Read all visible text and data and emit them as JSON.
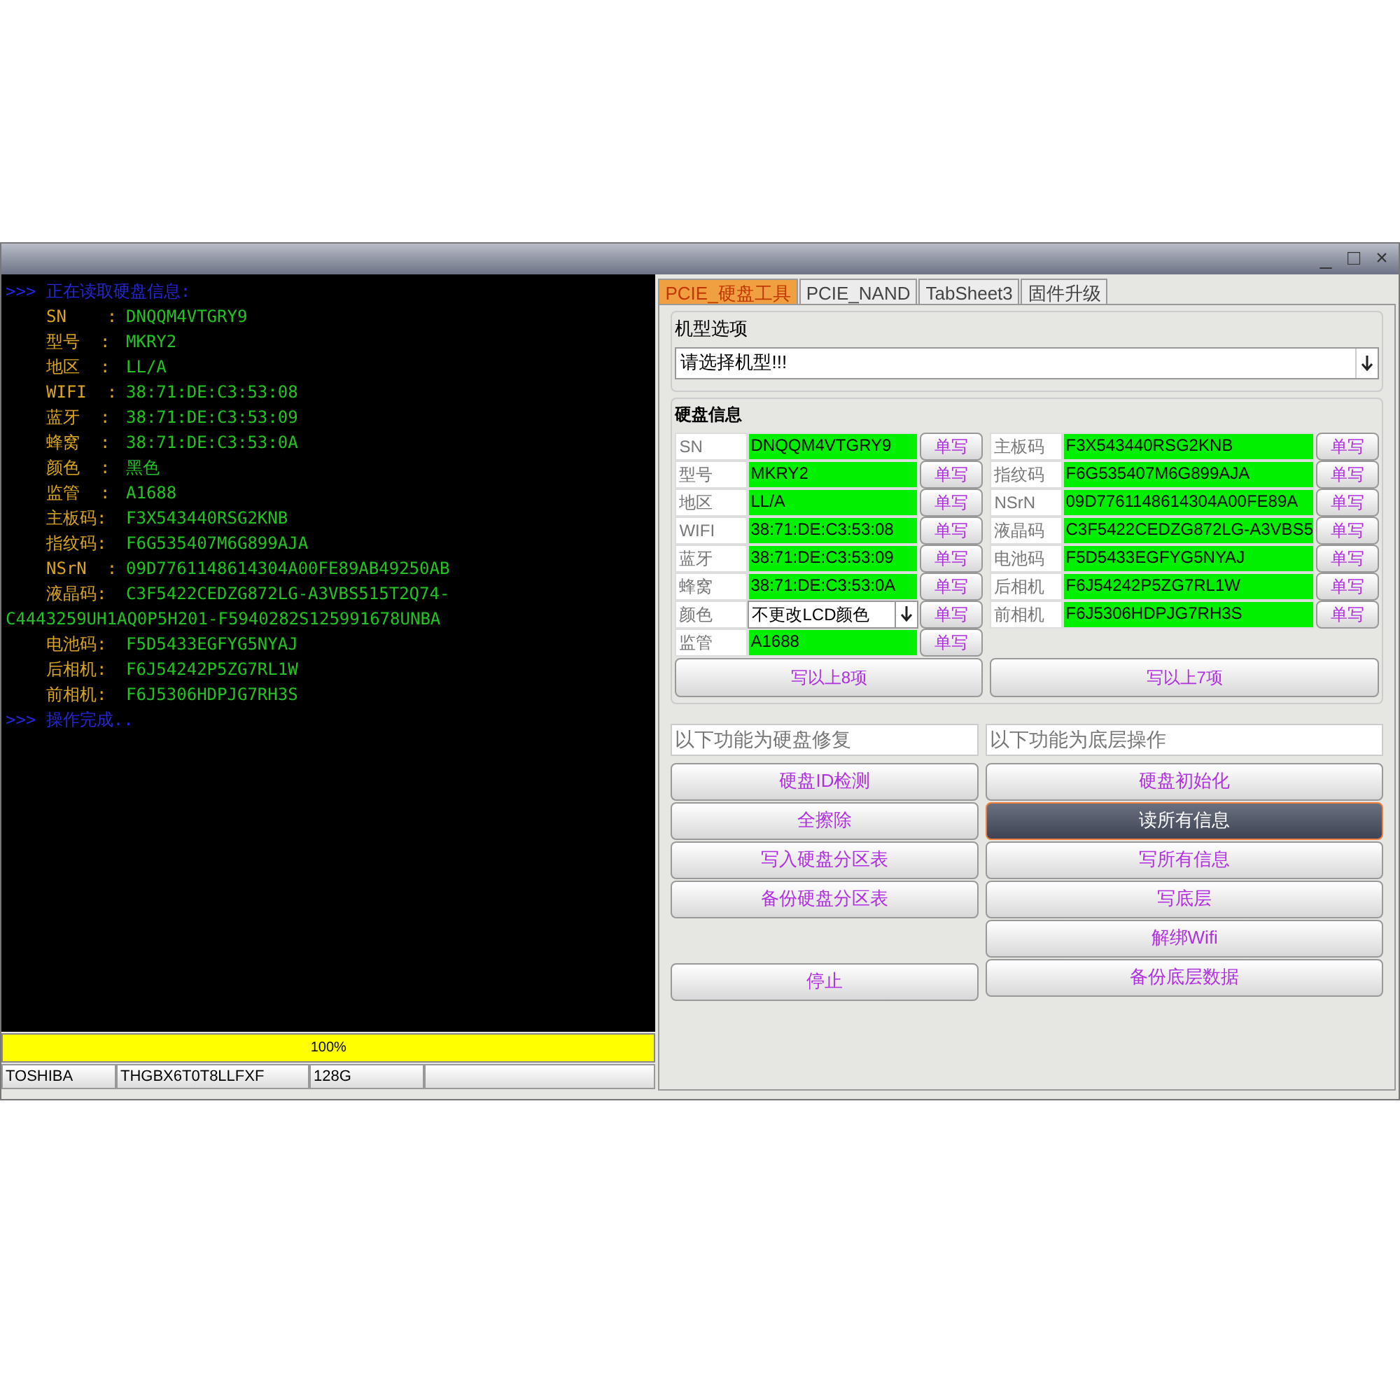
{
  "window": {
    "controls": [
      "_",
      "□",
      "×"
    ]
  },
  "console": {
    "lines": [
      {
        "kind": "header",
        "text": ">>> 正在读取硬盘信息:"
      },
      {
        "kind": "field",
        "label": "SN    :",
        "value": "DNQQM4VTGRY9"
      },
      {
        "kind": "field",
        "label": "型号  :",
        "value": "MKRY2"
      },
      {
        "kind": "field",
        "label": "地区  :",
        "value": "LL/A"
      },
      {
        "kind": "field",
        "label": "WIFI  :",
        "value": "38:71:DE:C3:53:08"
      },
      {
        "kind": "field",
        "label": "蓝牙  :",
        "value": "38:71:DE:C3:53:09"
      },
      {
        "kind": "field",
        "label": "蜂窝  :",
        "value": "38:71:DE:C3:53:0A"
      },
      {
        "kind": "field",
        "label": "颜色  :",
        "value": "黑色"
      },
      {
        "kind": "field",
        "label": "监管  :",
        "value": "A1688"
      },
      {
        "kind": "field",
        "label": "主板码:",
        "value": "F3X543440RSG2KNB"
      },
      {
        "kind": "field",
        "label": "指纹码:",
        "value": "F6G535407M6G899AJA"
      },
      {
        "kind": "field",
        "label": "NSrN  :",
        "value": "09D7761148614304A00FE89AB49250AB"
      },
      {
        "kind": "field",
        "label": "液晶码:",
        "value": "C3F5422CEDZG872LG-A3VBS515T2Q74-"
      },
      {
        "kind": "continuation",
        "text": "C4443259UH1AQ0P5H201-F5940282S125991678UNBA"
      },
      {
        "kind": "field",
        "label": "电池码:",
        "value": "F5D5433EGFYG5NYAJ"
      },
      {
        "kind": "field",
        "label": "后相机:",
        "value": "F6J54242P5ZG7RL1W"
      },
      {
        "kind": "field",
        "label": "前相机:",
        "value": "F6J5306HDPJG7RH3S"
      },
      {
        "kind": "header",
        "text": ">>> 操作完成.."
      }
    ]
  },
  "progress": {
    "level": 1,
    "text": "100%"
  },
  "status_bar": [
    "TOSHIBA",
    "THGBX6T0T8LLFXF",
    "128G"
  ],
  "tabs": [
    {
      "label": "PCIE_硬盘工具",
      "selected": true
    },
    {
      "label": "PCIE_NAND",
      "selected": false
    },
    {
      "label": "TabSheet3",
      "selected": false
    },
    {
      "label": "固件升级",
      "selected": false
    }
  ],
  "model_group": {
    "title": "机型选项",
    "dropdown": "请选择机型!!!"
  },
  "info_group": {
    "title": "硬盘信息",
    "left_rows": [
      {
        "kind": "text",
        "label": "SN",
        "value": "DNQQM4VTGRY9",
        "button": "单写"
      },
      {
        "kind": "text",
        "label": "型号",
        "value": "MKRY2",
        "button": "单写"
      },
      {
        "kind": "text",
        "label": "地区",
        "value": "LL/A",
        "button": "单写"
      },
      {
        "kind": "text",
        "label": "WIFI",
        "value": "38:71:DE:C3:53:08",
        "button": "单写"
      },
      {
        "kind": "text",
        "label": "蓝牙",
        "value": "38:71:DE:C3:53:09",
        "button": "单写"
      },
      {
        "kind": "text",
        "label": "蜂窝",
        "value": "38:71:DE:C3:53:0A",
        "button": "单写"
      },
      {
        "kind": "dropdown",
        "label": "颜色",
        "value": "不更改LCD颜色",
        "button": "单写"
      },
      {
        "kind": "text",
        "label": "监管",
        "value": "A1688",
        "button": "单写"
      }
    ],
    "right_rows": [
      {
        "kind": "text",
        "label": "主板码",
        "value": "F3X543440RSG2KNB",
        "button": "单写"
      },
      {
        "kind": "text",
        "label": "指纹码",
        "value": "F6G535407M6G899AJA",
        "button": "单写"
      },
      {
        "kind": "text",
        "label": "NSrN",
        "value": "09D7761148614304A00FE89A",
        "button": "单写"
      },
      {
        "kind": "text",
        "label": "液晶码",
        "value": "C3F5422CEDZG872LG-A3VBS5",
        "button": "单写"
      },
      {
        "kind": "text",
        "label": "电池码",
        "value": "F5D5433EGFYG5NYAJ",
        "button": "单写"
      },
      {
        "kind": "text",
        "label": "后相机",
        "value": "F6J54242P5ZG7RL1W",
        "button": "单写"
      },
      {
        "kind": "text",
        "label": "前相机",
        "value": "F6J5306HDPJG7RH3S",
        "button": "单写"
      }
    ],
    "left_write_button": "写以上8项",
    "right_write_button": "写以上7项"
  },
  "repair": {
    "title": "以下功能为硬盘修复",
    "buttons": [
      {
        "label": "硬盘ID检测",
        "highlighted": false
      },
      {
        "label": "全擦除",
        "highlighted": false
      },
      {
        "label": "写入硬盘分区表",
        "highlighted": false
      },
      {
        "label": "备份硬盘分区表",
        "highlighted": false
      }
    ],
    "stop_button": "停止"
  },
  "low_level": {
    "title": "以下功能为底层操作",
    "buttons": [
      {
        "label": "硬盘初始化",
        "highlighted": false
      },
      {
        "label": "读所有信息",
        "highlighted": true
      },
      {
        "label": "写所有信息",
        "highlighted": false
      },
      {
        "label": "写底层",
        "highlighted": false
      },
      {
        "label": "解绑Wifi",
        "highlighted": false
      },
      {
        "label": "备份底层数据",
        "highlighted": false
      }
    ]
  }
}
